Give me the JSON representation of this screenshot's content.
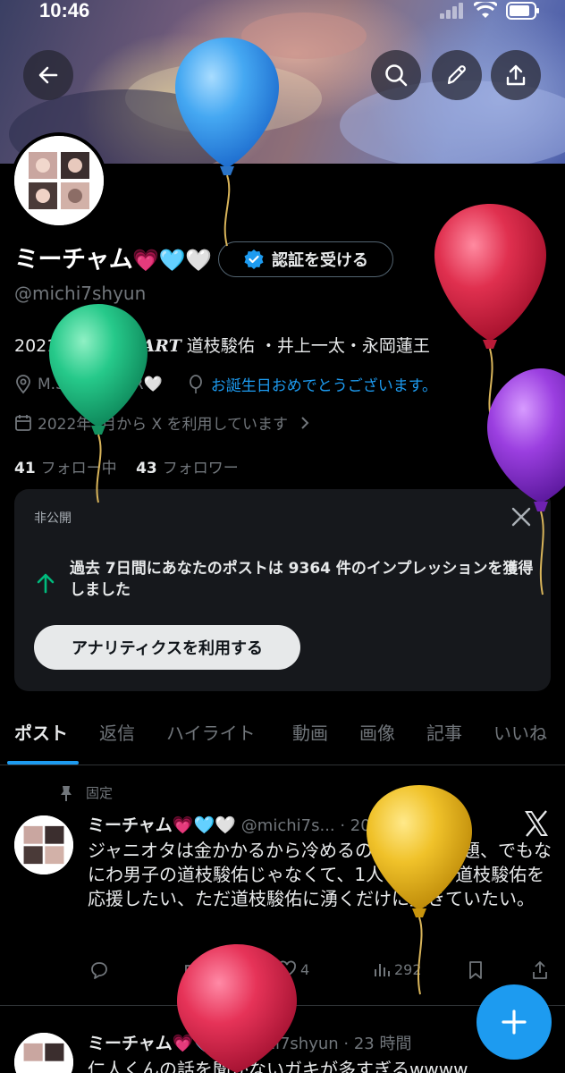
{
  "status_bar": {
    "time": "10:46"
  },
  "header": {
    "back_icon": "arrow-left-icon",
    "search_icon": "search-icon",
    "edit_icon": "pencil-icon",
    "share_icon": "share-icon"
  },
  "profile": {
    "display_name": "ミーチャム",
    "name_emojis": "💗🩵🤍",
    "verify_button": "認証を受ける",
    "handle": "@michi7shyun",
    "bio_prefix": "2021:11:12 ",
    "bio_fancy": "START",
    "bio_suffix": " 道枝駿佑 ・井上一太・永岡蓮王",
    "location": "M.S💚I.I💚N.R🤍",
    "birthday": "お誕生日おめでとうございます。",
    "joined": "2022年3月から X を利用しています",
    "following_count": "41",
    "following_label": "フォロー中",
    "followers_count": "43",
    "followers_label": "フォロワー"
  },
  "analytics_card": {
    "private_label": "非公開",
    "message": "過去 7日間にあなたのポストは 9364 件のインプレッションを獲得しました",
    "button": "アナリティクスを利用する"
  },
  "tabs": [
    "ポスト",
    "返信",
    "ハイライト",
    "動画",
    "画像",
    "記事",
    "いいね"
  ],
  "pinned_label": "固定",
  "posts": [
    {
      "name": "ミーチャム",
      "emojis": "💗🩵🤍",
      "handle_time": "@michi7s... · 2024/04/29",
      "text": "ジャニオタは金かかるから冷めるのも時間の問題、でもなにわ男子の道枝駿佑じゃなくて、1人の人間の道枝駿佑を応援したい、ただ道枝駿佑に湧くだけに生きていたい。",
      "likes": "4",
      "views": "292"
    },
    {
      "name": "ミーチャム",
      "emojis": "💗🩵",
      "handle_time": "@michi7shyun · 23 時間",
      "text": "仁人くんの話を聞かないガキが多すぎるwwww"
    }
  ],
  "colors": {
    "accent": "#1d9bf0",
    "background": "#000000",
    "card": "#16181c",
    "muted": "#71767b"
  }
}
